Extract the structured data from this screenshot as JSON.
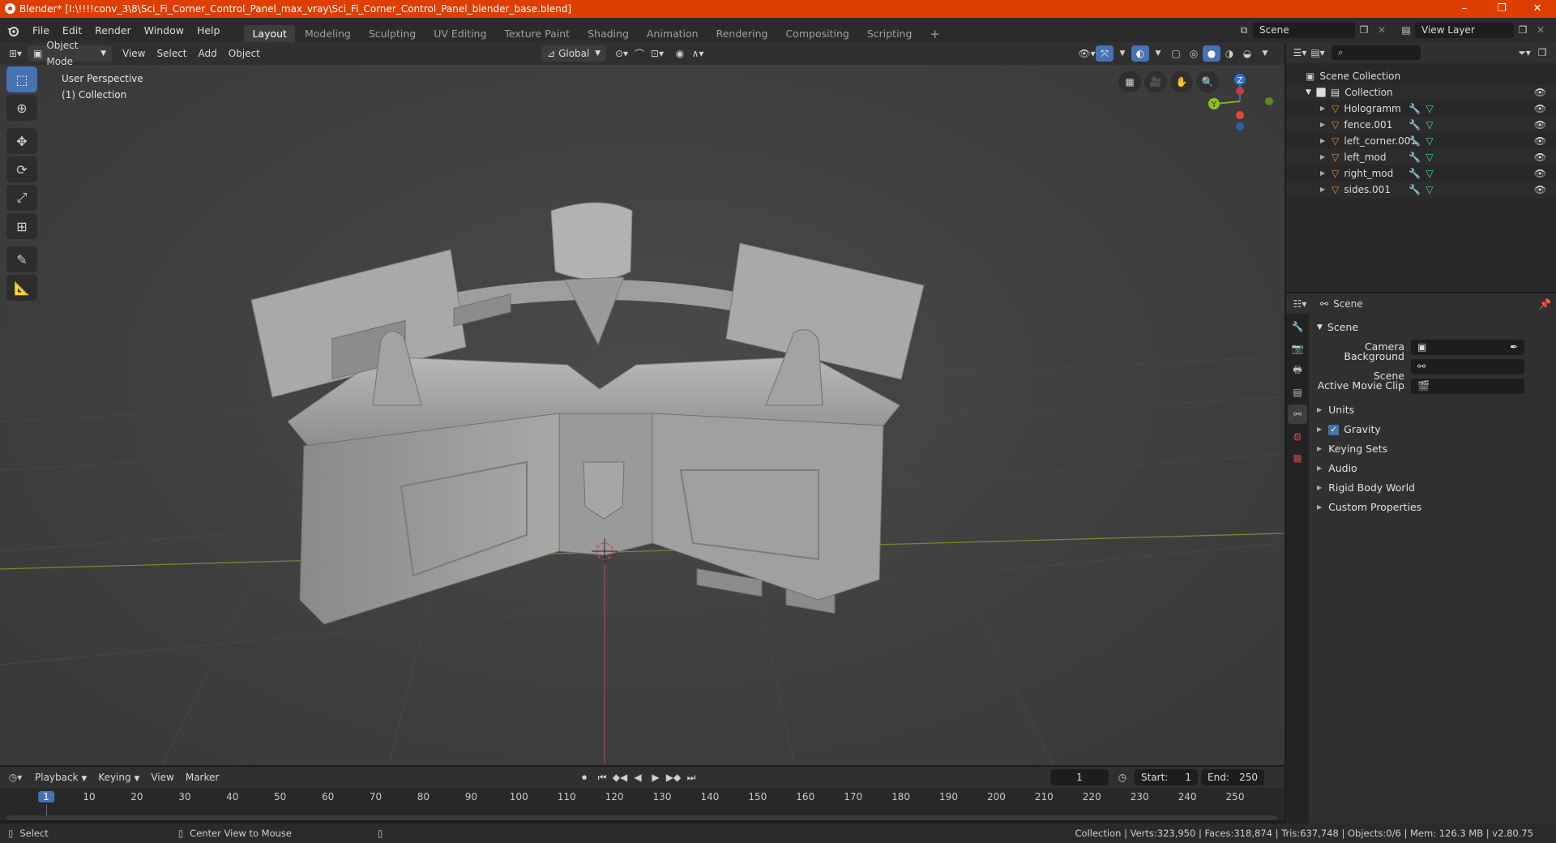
{
  "window": {
    "title": "Blender* [I:\\!!!!conv_3\\8\\Sci_Fi_Corner_Control_Panel_max_vray\\Sci_Fi_Corner_Control_Panel_blender_base.blend]",
    "minimize": "–",
    "maximize": "❐",
    "close": "✕"
  },
  "menu": {
    "file": "File",
    "edit": "Edit",
    "render": "Render",
    "window": "Window",
    "help": "Help"
  },
  "workspaces": [
    "Layout",
    "Modeling",
    "Sculpting",
    "UV Editing",
    "Texture Paint",
    "Shading",
    "Animation",
    "Rendering",
    "Compositing",
    "Scripting"
  ],
  "workspace_add": "+",
  "scene_field": "Scene",
  "view_layer_field": "View Layer",
  "viewport_header": {
    "mode": "Object Mode",
    "view": "View",
    "select": "Select",
    "add": "Add",
    "object": "Object",
    "orientation": "Global"
  },
  "viewport": {
    "perspective": "User Perspective",
    "collection": "(1) Collection",
    "gizmo_z": "Z",
    "gizmo_y": "Y"
  },
  "outliner": {
    "search_placeholder": "",
    "scene_collection": "Scene Collection",
    "collection": "Collection",
    "objects": [
      {
        "name": "Hologramm"
      },
      {
        "name": "fence.001"
      },
      {
        "name": "left_corner.001"
      },
      {
        "name": "left_mod"
      },
      {
        "name": "right_mod"
      },
      {
        "name": "sides.001"
      }
    ]
  },
  "properties": {
    "context": "Scene",
    "panel_scene": "Scene",
    "camera_label": "Camera",
    "background_scene_label": "Background Scene",
    "active_movie_clip_label": "Active Movie Clip",
    "sections": [
      "Units",
      "Gravity",
      "Keying Sets",
      "Audio",
      "Rigid Body World",
      "Custom Properties"
    ],
    "gravity_checked": true
  },
  "timeline": {
    "playback": "Playback",
    "keying": "Keying",
    "view": "View",
    "marker": "Marker",
    "current_frame": "1",
    "start_label": "Start:",
    "start_value": "1",
    "end_label": "End:",
    "end_value": "250",
    "ticks": [
      "1",
      "10",
      "20",
      "30",
      "40",
      "50",
      "60",
      "70",
      "80",
      "90",
      "100",
      "110",
      "120",
      "130",
      "140",
      "150",
      "160",
      "170",
      "180",
      "190",
      "200",
      "210",
      "220",
      "230",
      "240",
      "250"
    ]
  },
  "statusbar": {
    "select": "Select",
    "center_view": "Center View to Mouse",
    "stats": "Collection | Verts:323,950 | Faces:318,874 | Tris:637,748 | Objects:0/6 | Mem: 126.3 MB | v2.80.75"
  },
  "colors": {
    "title_bar": "#de3e00",
    "accent_blue": "#4772b3",
    "mesh_orange": "#e8873a",
    "axis_x": "#c23e3e",
    "axis_y": "#7fb01e",
    "axis_z": "#2f6fd1"
  }
}
